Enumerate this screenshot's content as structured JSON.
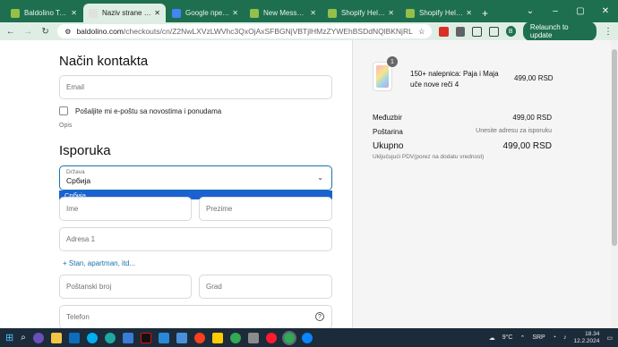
{
  "browser": {
    "tabs": [
      {
        "title": "Baldolino Toys & l",
        "color": "#95bf47",
        "active": false
      },
      {
        "title": "Naziv strane - Bald",
        "color": "#e0e0e0",
        "active": true
      },
      {
        "title": "Google преводил",
        "color": "#4285f4",
        "active": false
      },
      {
        "title": "New Message - Sh",
        "color": "#95bf47",
        "active": false
      },
      {
        "title": "Shopify Help Cent",
        "color": "#95bf47",
        "active": false
      },
      {
        "title": "Shopify Help Cent",
        "color": "#95bf47",
        "active": false
      }
    ],
    "url_domain": "baldolino.com",
    "url_path": "/checkouts/cn/Z2NwLXVzLWVhc3QxOjAxSFBGNjVBTjlHMzZYWEhBSDdNQlBKNjRL",
    "relaunch_label": "Relaunch to update",
    "avatar_letter": "B"
  },
  "contact": {
    "heading": "Način kontakta",
    "email_placeholder": "Email",
    "newsletter_label": "Pošaljite mi e-poštu sa novostima i ponudama",
    "opis": "Opis"
  },
  "delivery": {
    "heading": "Isporuka",
    "country_label": "Država",
    "country_value": "Србија",
    "dropdown_option": "Србија",
    "first_name_placeholder": "Ime",
    "last_name_placeholder": "Prezime",
    "address_placeholder": "Adresa 1",
    "add_apartment_link": "+ Stan, apartman, itd...",
    "postal_placeholder": "Poštanski broj",
    "city_placeholder": "Grad",
    "phone_placeholder": "Telefon"
  },
  "summary": {
    "product_name": "150+ nalepnica: Paja i Maja uče nove reči 4",
    "product_qty": "1",
    "product_price": "499,00 RSD",
    "subtotal_label": "Međuzbir",
    "subtotal_value": "499,00 RSD",
    "shipping_label": "Poštarina",
    "shipping_value": "Unesite adresu za isporuku",
    "total_label": "Ukupno",
    "total_value": "499,00 RSD",
    "tax_note": "Uključujući PDV(porez na dodatu vrednost)"
  },
  "taskbar": {
    "weather": "9°C",
    "lang": "SRP",
    "time": "18.34",
    "date": "12.2.2024"
  }
}
